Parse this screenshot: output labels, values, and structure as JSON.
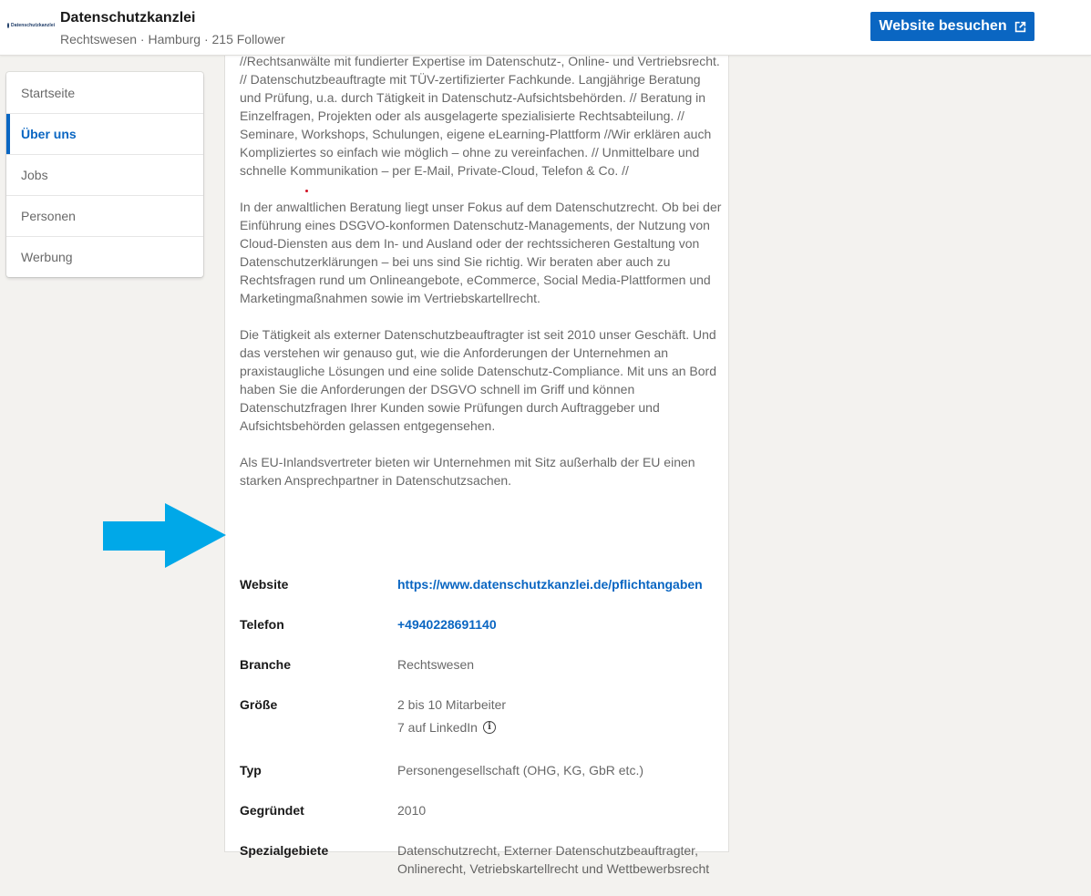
{
  "header": {
    "logo_text": "Datenschutzkanzlei",
    "company_name": "Datenschutzkanzlei",
    "meta": "Rechtswesen · Hamburg · 215 Follower",
    "visit_button_label": "Website besuchen"
  },
  "nav": {
    "items": [
      {
        "label": "Startseite",
        "active": false
      },
      {
        "label": "Über uns",
        "active": true
      },
      {
        "label": "Jobs",
        "active": false
      },
      {
        "label": "Personen",
        "active": false
      },
      {
        "label": "Werbung",
        "active": false
      }
    ]
  },
  "about": {
    "paragraphs": [
      "//Rechtsanwälte mit fundierter Expertise im Datenschutz-, Online- und Vertriebsrecht. // Datenschutzbeauftragte mit TÜV-zertifizierter Fachkunde. Langjährige Beratung und Prüfung, u.a. durch Tätigkeit in Datenschutz-Aufsichtsbehörden. // Beratung in Einzelfragen, Projekten oder als ausgelagerte spezialisierte Rechtsabteilung. // Seminare, Workshops, Schulungen, eigene eLearning-Plattform //Wir erklären auch Kompliziertes so einfach wie möglich – ohne zu vereinfachen. // Unmittelbare und schnelle Kommunikation – per E-Mail, Private-Cloud, Telefon & Co. //",
      "In der anwaltlichen Beratung liegt unser Fokus auf dem Datenschutzrecht. Ob bei der Einführung eines DSGVO-konformen Datenschutz-Managements, der Nutzung von Cloud-Diensten aus dem In- und Ausland oder der rechtssicheren Gestaltung von Datenschutzerklärungen – bei uns sind Sie richtig. Wir beraten aber auch zu Rechtsfragen rund um Onlineangebote, eCommerce, Social Media-Plattformen und Marketingmaßnahmen sowie im Vertriebskartellrecht.",
      "Die Tätigkeit als externer Datenschutzbeauftragter ist seit 2010 unser Geschäft. Und das verstehen wir genauso gut, wie die Anforderungen der Unternehmen an praxistaugliche Lösungen und eine solide Datenschutz-Compliance. Mit uns an Bord haben Sie die Anforderungen der DSGVO schnell im Griff und können Datenschutzfragen Ihrer Kunden sowie Prüfungen durch Auftraggeber und Aufsichtsbehörden gelassen entgegensehen.",
      "Als EU-Inlandsvertreter bieten wir Unternehmen mit Sitz außerhalb der EU einen starken Ansprechpartner in Datenschutzsachen."
    ]
  },
  "details": {
    "website": {
      "label": "Website",
      "value": "https://www.datenschutzkanzlei.de/pflichtangaben"
    },
    "phone": {
      "label": "Telefon",
      "value": "+4940228691140"
    },
    "industry": {
      "label": "Branche",
      "value": "Rechtswesen"
    },
    "size": {
      "label": "Größe",
      "value": "2 bis 10 Mitarbeiter",
      "sub": "7 auf LinkedIn"
    },
    "type": {
      "label": "Typ",
      "value": "Personengesellschaft (OHG, KG, GbR etc.)"
    },
    "founded": {
      "label": "Gegründet",
      "value": "2010"
    },
    "specialties": {
      "label": "Spezialgebiete",
      "value": "Datenschutzrecht, Externer Datenschutzbeauftragter, Onlinerecht, Vetriebskartellrecht und Wettbewerbsrecht"
    }
  },
  "colors": {
    "accent": "#0a66c2",
    "arrow": "#00a8e8",
    "background": "#f3f2ef"
  },
  "icons": {
    "visit": "external-link-icon",
    "size_info": "info-icon"
  }
}
